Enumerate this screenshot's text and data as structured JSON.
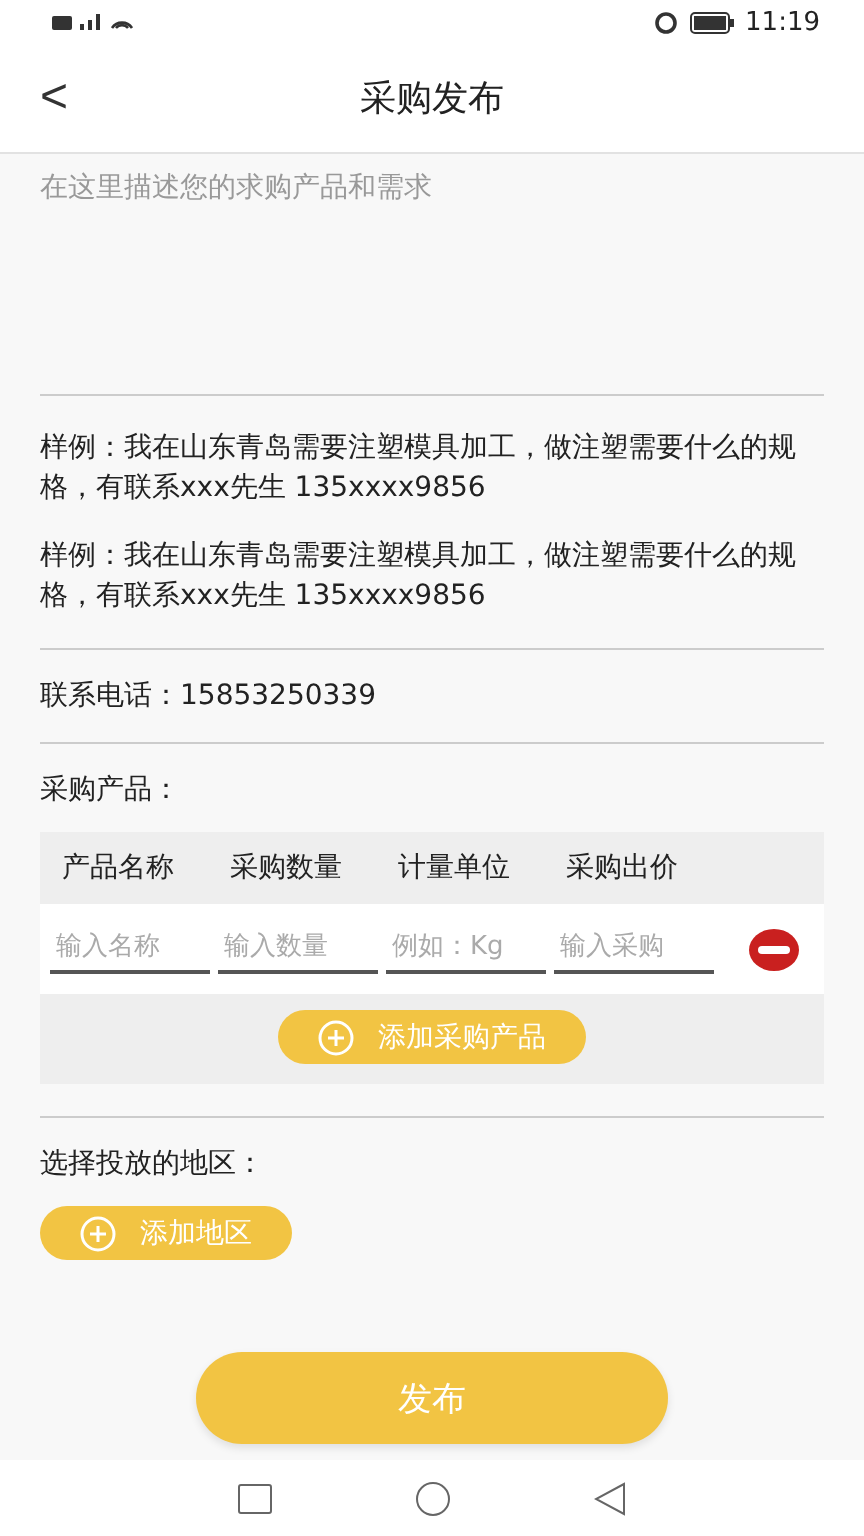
{
  "status_bar": {
    "time": "11:19"
  },
  "header": {
    "back": "<",
    "title": "采购发布"
  },
  "description": {
    "placeholder": "在这里描述您的求购产品和需求"
  },
  "examples": [
    "样例：我在山东青岛需要注塑模具加工，做注塑需要什么的规格，有联系xxx先生 135xxxx9856",
    "样例：我在山东青岛需要注塑模具加工，做注塑需要什么的规格，有联系xxx先生 135xxxx9856"
  ],
  "phone": "联系电话：15853250339",
  "products": {
    "label": "采购产品：",
    "columns": [
      "产品名称",
      "采购数量",
      "计量单位",
      "采购出价"
    ],
    "rows": [
      {
        "placeholders": [
          "输入名称",
          "输入数量",
          "例如：Kg",
          "输入采购"
        ]
      }
    ],
    "add_button": "添加采购产品"
  },
  "region": {
    "label": "选择投放的地区：",
    "add_button": "添加地区"
  },
  "publish_button": "发布"
}
